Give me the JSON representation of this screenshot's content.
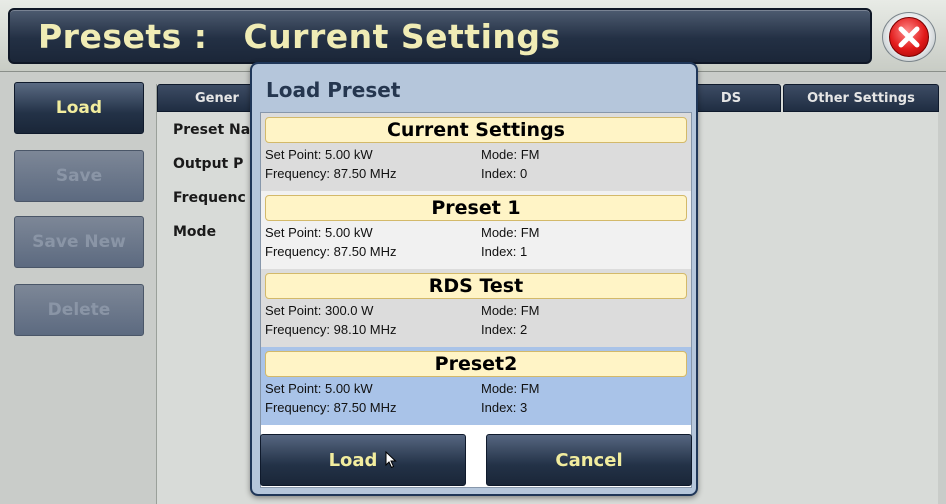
{
  "title": {
    "prefix": "Presets :",
    "name": "Current Settings"
  },
  "close_icon": "close-icon",
  "sidebar": {
    "buttons": [
      {
        "label": "Load",
        "state": "active"
      },
      {
        "label": "Save",
        "state": "disabled"
      },
      {
        "label": "Save New",
        "state": "disabled"
      },
      {
        "label": "Delete",
        "state": "disabled"
      }
    ]
  },
  "tabs": [
    {
      "label": "Gener"
    },
    {
      "label": "DS"
    },
    {
      "label": "Other Settings"
    }
  ],
  "fields": [
    {
      "label": "Preset Na"
    },
    {
      "label": "Output P"
    },
    {
      "label": "Frequenc"
    },
    {
      "label": "Mode"
    }
  ],
  "modal": {
    "title": "Load Preset",
    "presets": [
      {
        "name": "Current Settings",
        "set_point": "Set Point: 5.00 kW",
        "mode": "Mode: FM",
        "frequency": "Frequency: 87.50 MHz",
        "index": "Index: 0"
      },
      {
        "name": "Preset 1",
        "set_point": "Set Point: 5.00 kW",
        "mode": "Mode: FM",
        "frequency": "Frequency: 87.50 MHz",
        "index": "Index: 1"
      },
      {
        "name": "RDS Test",
        "set_point": "Set Point: 300.0 W",
        "mode": "Mode: FM",
        "frequency": "Frequency: 98.10 MHz",
        "index": "Index: 2"
      },
      {
        "name": "Preset2",
        "set_point": "Set Point: 5.00 kW",
        "mode": "Mode: FM",
        "frequency": "Frequency: 87.50 MHz",
        "index": "Index: 3"
      }
    ],
    "selected_index": 3,
    "load_label": "Load",
    "cancel_label": "Cancel"
  },
  "colors": {
    "title_text": "#f0ecb5",
    "button_text": "#f2ed9e",
    "selected_row": "#a9c3e8",
    "preset_name_bg": "#fff4c6"
  }
}
